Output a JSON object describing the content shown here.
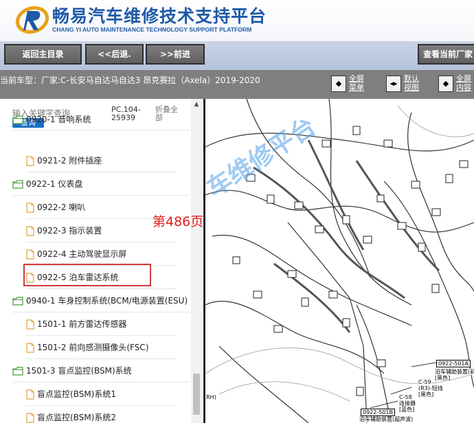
{
  "header": {
    "title": "畅易汽车维修技术支持平台",
    "subtitle": "CHANG YI AUTO MAINTENANCE TECHNOLOGY SUPPORT PLATFORM"
  },
  "nav": {
    "back_home": "返回主目录",
    "back": "<<后退.",
    "forward": ">>前进",
    "view_current": "查看当前厂家"
  },
  "current": {
    "label": "当前车型：",
    "value": "厂家:C-长安马自达马自达3 昂克赛拉（Axela）2019-2020"
  },
  "tools": {
    "fullscreen_menu": [
      "全屏",
      "菜单"
    ],
    "default_view": [
      "默认",
      "视图"
    ],
    "fullscreen_content": [
      "全屏",
      "内容"
    ]
  },
  "sidebar": {
    "search_placeholder": "输入关键字查询",
    "search_button": "查询",
    "pc_code": [
      "PC.104-",
      "25939"
    ],
    "collapse_all": [
      "折叠全",
      "部"
    ],
    "items": [
      {
        "label": "0920-1 音响系统",
        "type": "folder"
      },
      {
        "label": "0921-2 附件插座",
        "type": "doc"
      },
      {
        "label": "0922-1 仪表盘",
        "type": "folder"
      },
      {
        "label": "0922-2 喇叭",
        "type": "doc"
      },
      {
        "label": "0922-3 指示装置",
        "type": "doc"
      },
      {
        "label": "0922-4 主动驾驶显示屏",
        "type": "doc"
      },
      {
        "label": "0922-5 泊车雷达系统",
        "type": "doc"
      },
      {
        "label": "0940-1 车身控制系统(BCM/电源装置(ESU)",
        "type": "folder"
      },
      {
        "label": "1501-1 前方雷达传感器",
        "type": "doc"
      },
      {
        "label": "1501-2 前向感测摄像头(FSC)",
        "type": "doc"
      },
      {
        "label": "1501-3 盲点监控(BSM)系统",
        "type": "folder"
      },
      {
        "label": "盲点监控(BSM)系统1",
        "type": "doc"
      },
      {
        "label": "盲点监控(BSM)系统2",
        "type": "doc"
      }
    ]
  },
  "diagram": {
    "page_label": "第486页",
    "watermark": "车维修平台",
    "callouts": {
      "c1_code": "0922-501A",
      "c1_line1": "泊车辅助装置(前",
      "c1_line2": "[黑色]",
      "c2_code": "C-59",
      "c2_line1": "(R3)-短线",
      "c2_line2": "[黑色]",
      "c3_code": "C-58",
      "c3_line1": "连接器",
      "c3_line2": "[蓝色]",
      "c4_code": "0922-501B",
      "c4_line1": "泊车辅助装置(超声波)",
      "rh": "(RH)"
    }
  },
  "colors": {
    "brand": "#1f5aa8",
    "highlight": "#d23a3a",
    "page_label": "#e02020"
  }
}
